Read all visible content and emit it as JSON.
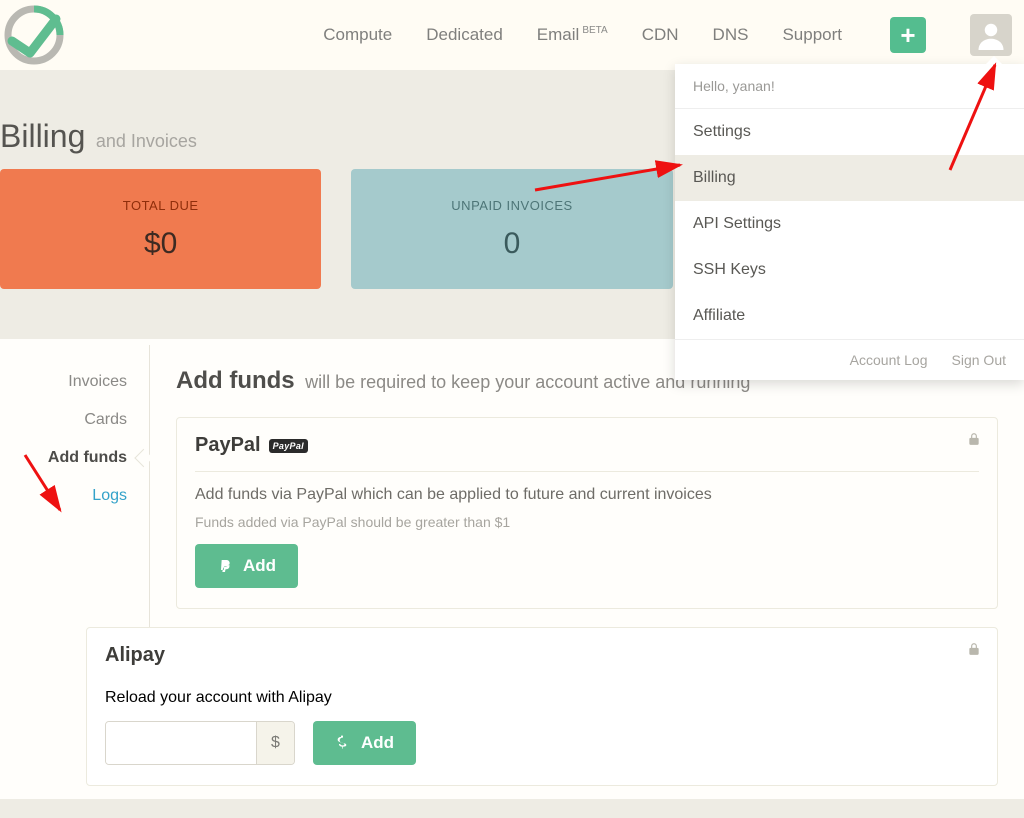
{
  "nav": {
    "items": [
      "Compute",
      "Dedicated",
      "Email",
      "CDN",
      "DNS",
      "Support"
    ],
    "email_badge": "BETA"
  },
  "dropdown": {
    "hello": "Hello, yanan!",
    "items": [
      "Settings",
      "Billing",
      "API Settings",
      "SSH Keys",
      "Affiliate"
    ],
    "footer": [
      "Account Log",
      "Sign Out"
    ]
  },
  "page": {
    "title": "Billing",
    "subtitle": "and Invoices"
  },
  "tiles": {
    "due_label": "TOTAL DUE",
    "due_value": "$0",
    "unpaid_label": "UNPAID INVOICES",
    "unpaid_value": "0"
  },
  "sidebar": {
    "items": [
      "Invoices",
      "Cards",
      "Add funds",
      "Logs"
    ]
  },
  "addfunds": {
    "title": "Add funds",
    "subtitle": "will be required to keep your account active and running",
    "paypal": {
      "name": "PayPal",
      "badge": "PayPal",
      "desc": "Add funds via PayPal which can be applied to future and current invoices",
      "note": "Funds added via PayPal should be greater than $1",
      "button": "Add"
    },
    "alipay": {
      "name": "Alipay",
      "desc": "Reload your account with Alipay",
      "currency": "$",
      "button": "Add"
    }
  }
}
